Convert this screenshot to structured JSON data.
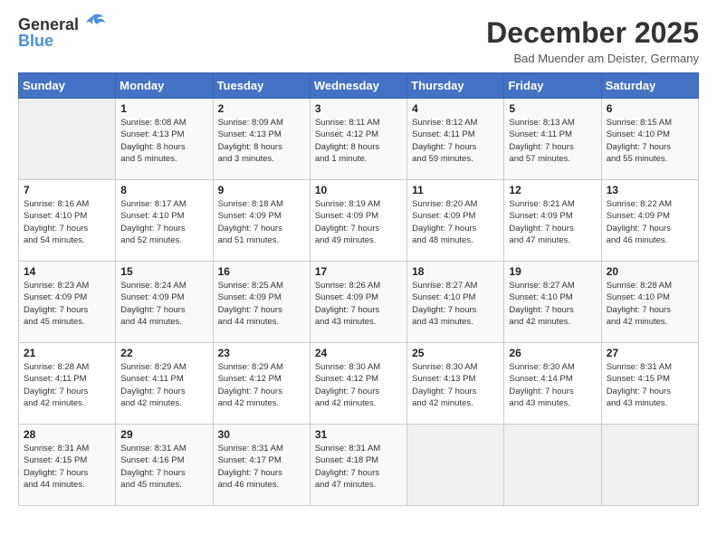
{
  "header": {
    "logo_line1": "General",
    "logo_line2": "Blue",
    "month_title": "December 2025",
    "location": "Bad Muender am Deister, Germany"
  },
  "days_of_week": [
    "Sunday",
    "Monday",
    "Tuesday",
    "Wednesday",
    "Thursday",
    "Friday",
    "Saturday"
  ],
  "weeks": [
    [
      {
        "day": "",
        "info": ""
      },
      {
        "day": "1",
        "info": "Sunrise: 8:08 AM\nSunset: 4:13 PM\nDaylight: 8 hours\nand 5 minutes."
      },
      {
        "day": "2",
        "info": "Sunrise: 8:09 AM\nSunset: 4:13 PM\nDaylight: 8 hours\nand 3 minutes."
      },
      {
        "day": "3",
        "info": "Sunrise: 8:11 AM\nSunset: 4:12 PM\nDaylight: 8 hours\nand 1 minute."
      },
      {
        "day": "4",
        "info": "Sunrise: 8:12 AM\nSunset: 4:11 PM\nDaylight: 7 hours\nand 59 minutes."
      },
      {
        "day": "5",
        "info": "Sunrise: 8:13 AM\nSunset: 4:11 PM\nDaylight: 7 hours\nand 57 minutes."
      },
      {
        "day": "6",
        "info": "Sunrise: 8:15 AM\nSunset: 4:10 PM\nDaylight: 7 hours\nand 55 minutes."
      }
    ],
    [
      {
        "day": "7",
        "info": "Sunrise: 8:16 AM\nSunset: 4:10 PM\nDaylight: 7 hours\nand 54 minutes."
      },
      {
        "day": "8",
        "info": "Sunrise: 8:17 AM\nSunset: 4:10 PM\nDaylight: 7 hours\nand 52 minutes."
      },
      {
        "day": "9",
        "info": "Sunrise: 8:18 AM\nSunset: 4:09 PM\nDaylight: 7 hours\nand 51 minutes."
      },
      {
        "day": "10",
        "info": "Sunrise: 8:19 AM\nSunset: 4:09 PM\nDaylight: 7 hours\nand 49 minutes."
      },
      {
        "day": "11",
        "info": "Sunrise: 8:20 AM\nSunset: 4:09 PM\nDaylight: 7 hours\nand 48 minutes."
      },
      {
        "day": "12",
        "info": "Sunrise: 8:21 AM\nSunset: 4:09 PM\nDaylight: 7 hours\nand 47 minutes."
      },
      {
        "day": "13",
        "info": "Sunrise: 8:22 AM\nSunset: 4:09 PM\nDaylight: 7 hours\nand 46 minutes."
      }
    ],
    [
      {
        "day": "14",
        "info": "Sunrise: 8:23 AM\nSunset: 4:09 PM\nDaylight: 7 hours\nand 45 minutes."
      },
      {
        "day": "15",
        "info": "Sunrise: 8:24 AM\nSunset: 4:09 PM\nDaylight: 7 hours\nand 44 minutes."
      },
      {
        "day": "16",
        "info": "Sunrise: 8:25 AM\nSunset: 4:09 PM\nDaylight: 7 hours\nand 44 minutes."
      },
      {
        "day": "17",
        "info": "Sunrise: 8:26 AM\nSunset: 4:09 PM\nDaylight: 7 hours\nand 43 minutes."
      },
      {
        "day": "18",
        "info": "Sunrise: 8:27 AM\nSunset: 4:10 PM\nDaylight: 7 hours\nand 43 minutes."
      },
      {
        "day": "19",
        "info": "Sunrise: 8:27 AM\nSunset: 4:10 PM\nDaylight: 7 hours\nand 42 minutes."
      },
      {
        "day": "20",
        "info": "Sunrise: 8:28 AM\nSunset: 4:10 PM\nDaylight: 7 hours\nand 42 minutes."
      }
    ],
    [
      {
        "day": "21",
        "info": "Sunrise: 8:28 AM\nSunset: 4:11 PM\nDaylight: 7 hours\nand 42 minutes."
      },
      {
        "day": "22",
        "info": "Sunrise: 8:29 AM\nSunset: 4:11 PM\nDaylight: 7 hours\nand 42 minutes."
      },
      {
        "day": "23",
        "info": "Sunrise: 8:29 AM\nSunset: 4:12 PM\nDaylight: 7 hours\nand 42 minutes."
      },
      {
        "day": "24",
        "info": "Sunrise: 8:30 AM\nSunset: 4:12 PM\nDaylight: 7 hours\nand 42 minutes."
      },
      {
        "day": "25",
        "info": "Sunrise: 8:30 AM\nSunset: 4:13 PM\nDaylight: 7 hours\nand 42 minutes."
      },
      {
        "day": "26",
        "info": "Sunrise: 8:30 AM\nSunset: 4:14 PM\nDaylight: 7 hours\nand 43 minutes."
      },
      {
        "day": "27",
        "info": "Sunrise: 8:31 AM\nSunset: 4:15 PM\nDaylight: 7 hours\nand 43 minutes."
      }
    ],
    [
      {
        "day": "28",
        "info": "Sunrise: 8:31 AM\nSunset: 4:15 PM\nDaylight: 7 hours\nand 44 minutes."
      },
      {
        "day": "29",
        "info": "Sunrise: 8:31 AM\nSunset: 4:16 PM\nDaylight: 7 hours\nand 45 minutes."
      },
      {
        "day": "30",
        "info": "Sunrise: 8:31 AM\nSunset: 4:17 PM\nDaylight: 7 hours\nand 46 minutes."
      },
      {
        "day": "31",
        "info": "Sunrise: 8:31 AM\nSunset: 4:18 PM\nDaylight: 7 hours\nand 47 minutes."
      },
      {
        "day": "",
        "info": ""
      },
      {
        "day": "",
        "info": ""
      },
      {
        "day": "",
        "info": ""
      }
    ]
  ]
}
